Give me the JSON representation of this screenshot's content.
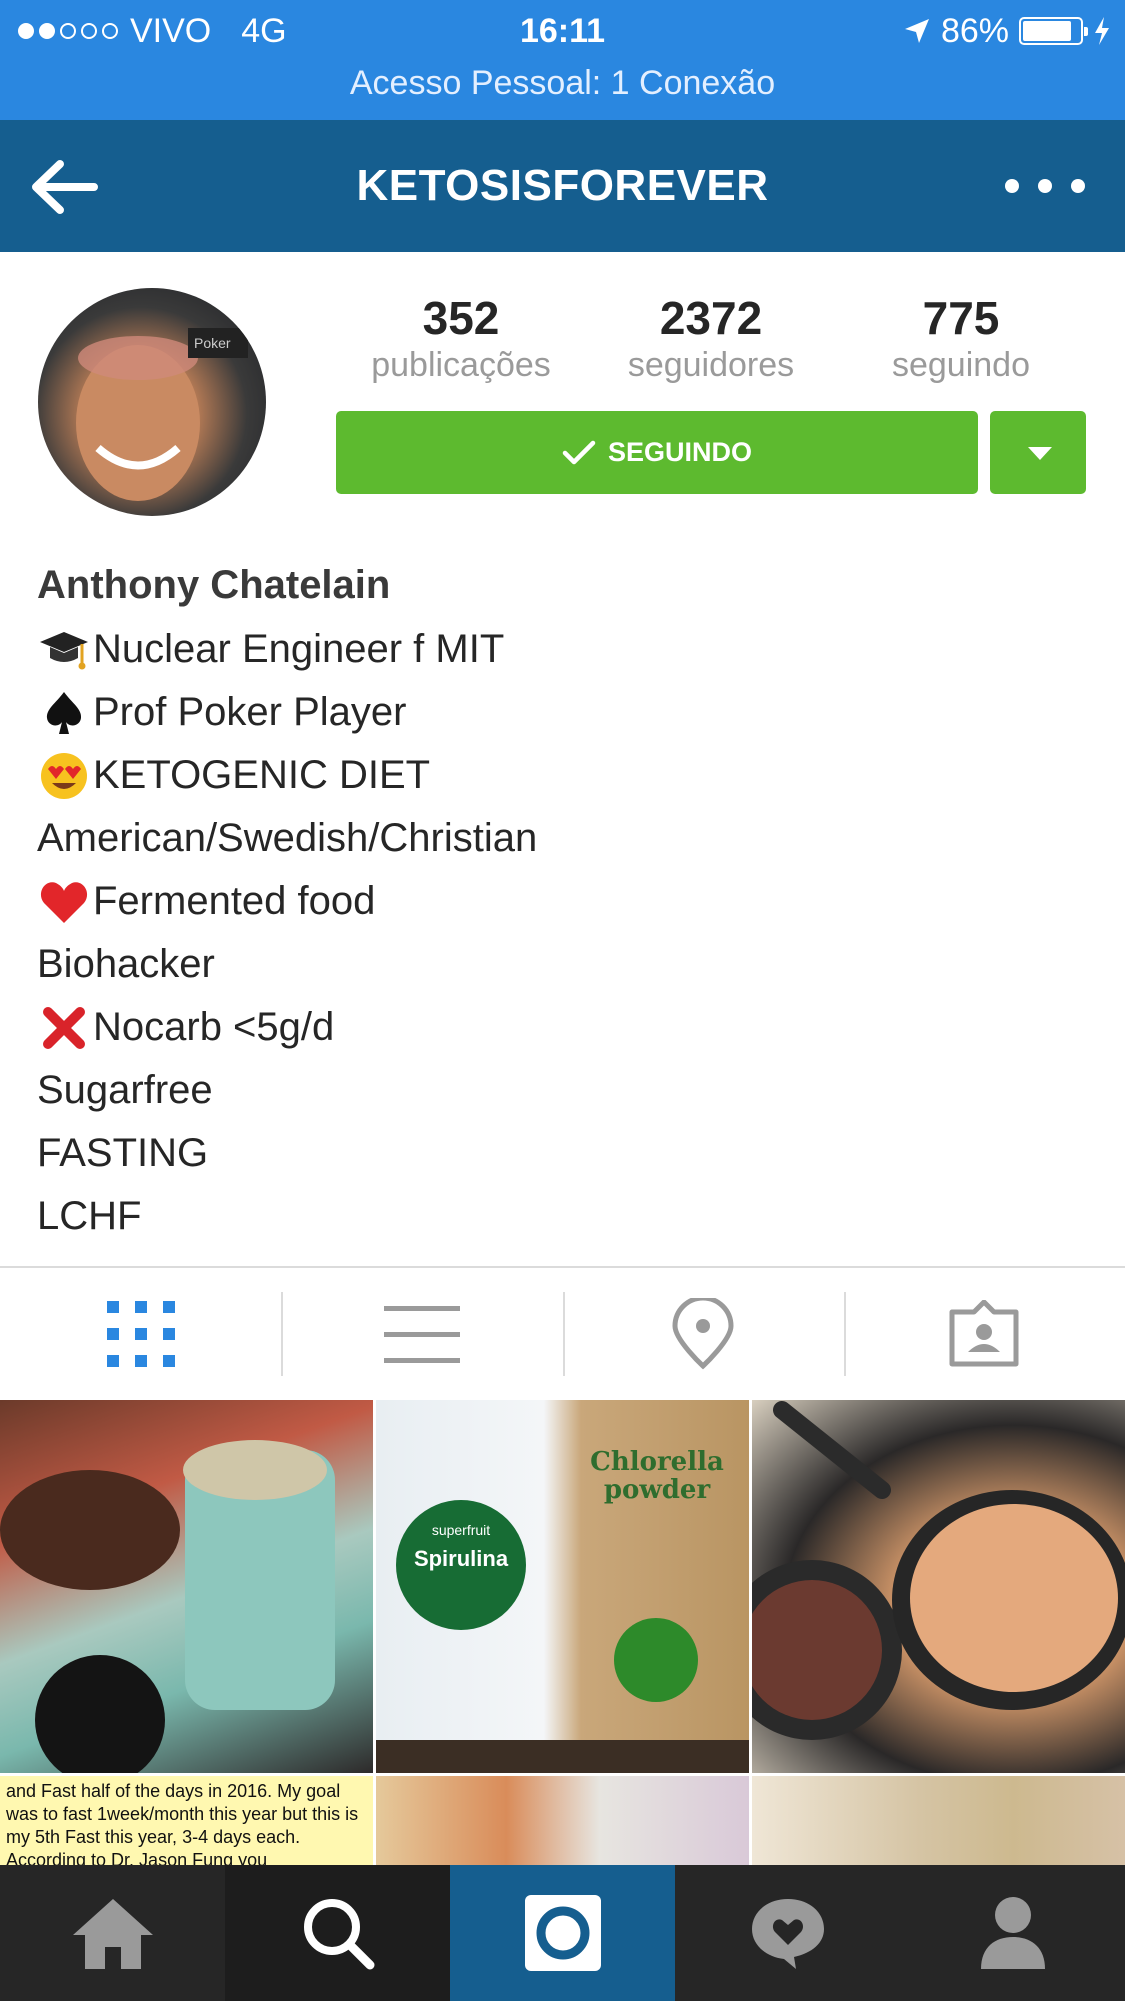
{
  "status_bar": {
    "signal": "●●○○○",
    "carrier": "VIVO",
    "network": "4G",
    "time": "16:11",
    "battery": "86%",
    "battery_level": 0.86,
    "hotspot": "Acesso Pessoal: 1 Conexão"
  },
  "header": {
    "title": "KETOSISFOREVER",
    "back_icon": "arrow-left-icon",
    "more_icon": "more-dots-icon"
  },
  "profile": {
    "stats": [
      {
        "value": "352",
        "label": "publicações"
      },
      {
        "value": "2372",
        "label": "seguidores"
      },
      {
        "value": "775",
        "label": "seguindo"
      }
    ],
    "follow_label": "SEGUINDO",
    "name": "Anthony Chatelain",
    "bio": [
      {
        "icon": "graduation-cap-icon",
        "text": "Nuclear Engineer f MIT"
      },
      {
        "icon": "spade-icon",
        "text": "Prof Poker Player"
      },
      {
        "icon": "heart-eyes-emoji-icon",
        "text": "KETOGENIC DIET"
      },
      {
        "icon": "",
        "text": "American/Swedish/Christian"
      },
      {
        "icon": "red-heart-icon",
        "text": "Fermented food"
      },
      {
        "icon": "",
        "text": "Biohacker"
      },
      {
        "icon": "red-cross-icon",
        "text": "Nocarb <5g/d"
      },
      {
        "icon": "",
        "text": "Sugarfree"
      },
      {
        "icon": "",
        "text": "FASTING"
      },
      {
        "icon": "",
        "text": "LCHF"
      }
    ]
  },
  "tabs": [
    "grid-view-icon",
    "list-view-icon",
    "location-pin-icon",
    "tagged-photos-icon"
  ],
  "grid": {
    "post2_text": "Spirulina",
    "post2_brand": "superfruit",
    "post2_box": "Chlorella powder",
    "post4_caption": "and Fast half of the days in 2016. My goal was to fast 1week/month this year but this is my 5th Fast this year, 3-4 days each. According to Dr. Jason Fung you"
  },
  "bottom_nav": [
    "home-icon",
    "search-icon",
    "camera-icon",
    "activity-heart-icon",
    "profile-icon"
  ],
  "colors": {
    "status_bar": "#2a87e0",
    "header": "#155e8f",
    "follow_button": "#5dba2f",
    "active_tab": "#2a87e0",
    "bottom_nav": "#262626"
  }
}
